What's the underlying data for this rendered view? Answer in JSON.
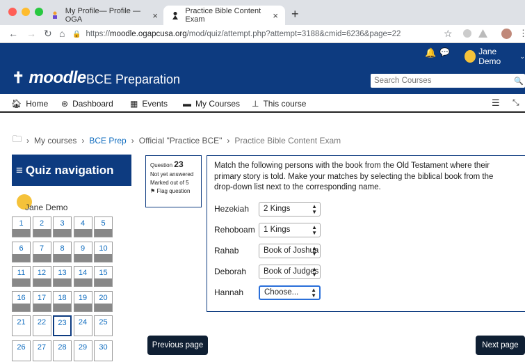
{
  "browser": {
    "tabs": [
      {
        "title": "My Profile— Profile — OGA",
        "icon": "moodle-favicon"
      },
      {
        "title": "Practice Bible Content Exam",
        "icon": "moodle-favicon"
      }
    ],
    "url_prefix": "https://",
    "url_domain": "moodle.ogapcusa.org",
    "url_path": "/mod/quiz/attempt.php?attempt=3188&cmid=6236&page=22",
    "new_tab_label": "+",
    "tab_close": "×"
  },
  "header": {
    "user_name": "Jane Demo",
    "logo_text": "moodle",
    "site_title": "BCE Preparation",
    "search_placeholder": "Search Courses"
  },
  "menu": [
    {
      "label": "Home",
      "icon": "home-icon"
    },
    {
      "label": "Dashboard",
      "icon": "dashboard-icon"
    },
    {
      "label": "Events",
      "icon": "calendar-icon"
    },
    {
      "label": "My Courses",
      "icon": "courses-icon"
    },
    {
      "label": "This course",
      "icon": "sitemap-icon"
    }
  ],
  "breadcrumb": [
    "My courses",
    "BCE Prep",
    "Official \"Practice BCE\"",
    "Practice Bible Content Exam"
  ],
  "breadcrumb_sep": "›",
  "quiz_nav": {
    "title": "Quiz navigation",
    "user_name": "Jane Demo",
    "buttons": [
      "1",
      "2",
      "3",
      "4",
      "5",
      "6",
      "7",
      "8",
      "9",
      "10",
      "11",
      "12",
      "13",
      "14",
      "15",
      "16",
      "17",
      "18",
      "19",
      "20",
      "21",
      "22",
      "23",
      "24",
      "25",
      "26",
      "27",
      "28",
      "29",
      "30"
    ],
    "current": "23"
  },
  "question": {
    "label": "Question",
    "number": "23",
    "status": "Not yet answered",
    "marked": "Marked out of 5",
    "flag": "Flag question",
    "text": "Match the following persons with the book from the Old Testament where their primary story is told. Make your matches by selecting the biblical book from the drop-down list next to the corresponding name.",
    "rows": [
      {
        "name": "Hezekiah",
        "value": "2 Kings"
      },
      {
        "name": "Rehoboam",
        "value": "1 Kings"
      },
      {
        "name": "Rahab",
        "value": "Book of Joshua"
      },
      {
        "name": "Deborah",
        "value": "Book of Judges"
      },
      {
        "name": "Hannah",
        "value": "Choose..."
      }
    ]
  },
  "buttons": {
    "previous": "Previous page",
    "next": "Next page"
  },
  "colors": {
    "brand": "#0d3b80",
    "link": "#0f6cbf",
    "button_dark": "#0f1f33"
  }
}
